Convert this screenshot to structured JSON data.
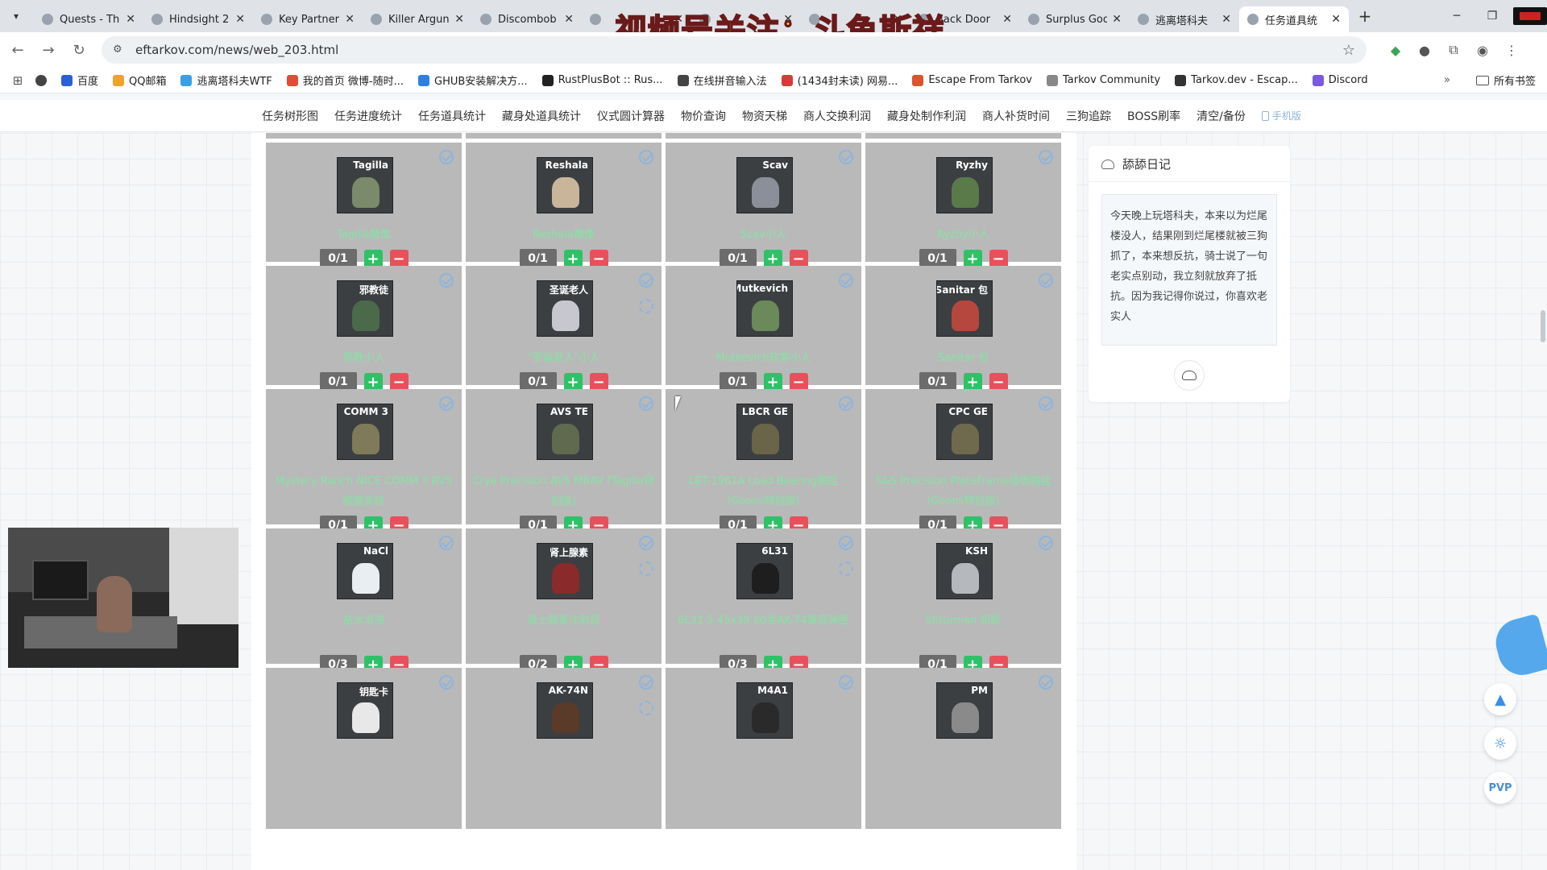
{
  "browser": {
    "tabs": [
      {
        "title": "Quests - Th",
        "active": false
      },
      {
        "title": "Hindsight 2",
        "active": false
      },
      {
        "title": "Key Partner",
        "active": false
      },
      {
        "title": "Killer Argun",
        "active": false
      },
      {
        "title": "Discombob",
        "active": false
      },
      {
        "title": "",
        "active": false
      },
      {
        "title": "",
        "active": false
      },
      {
        "title": "",
        "active": false
      },
      {
        "title": "Back Door",
        "active": false
      },
      {
        "title": "Surplus Goo",
        "active": false
      },
      {
        "title": "逃离塔科夫",
        "active": false
      },
      {
        "title": "任务道具统",
        "active": true
      }
    ],
    "url": "eftarkov.com/news/web_203.html",
    "bookmarks": [
      {
        "label": "百度",
        "color": "#2b5fd6"
      },
      {
        "label": "QQ邮箱",
        "color": "#f0a22a"
      },
      {
        "label": "逃离塔科夫WTF",
        "color": "#3aa0e6"
      },
      {
        "label": "我的首页 微博-随时...",
        "color": "#e24b3a"
      },
      {
        "label": "GHUB安装解决方...",
        "color": "#2f7fe0"
      },
      {
        "label": "RustPlusBot :: Rus...",
        "color": "#222222"
      },
      {
        "label": "在线拼音输入法",
        "color": "#444444"
      },
      {
        "label": "(1434封未读) 网易...",
        "color": "#d83a3a"
      },
      {
        "label": "Escape From Tarkov",
        "color": "#d9552b"
      },
      {
        "label": "Tarkov Community",
        "color": "#888888"
      },
      {
        "label": "Tarkov.dev - Escap...",
        "color": "#333333"
      },
      {
        "label": "Discord",
        "color": "#7a5ae0"
      }
    ],
    "all_bookmarks": "所有书签",
    "more": "»"
  },
  "watermark": "视频号关注：斗鱼斯祥、",
  "sitenav": {
    "items": [
      "任务树形图",
      "任务进度统计",
      "任务道具统计",
      "藏身处道具统计",
      "仪式圆计算器",
      "物价查询",
      "物资天梯",
      "商人交换利润",
      "藏身处制作利润",
      "商人补货时间",
      "三狗追踪",
      "BOSS刷率",
      "清空/备份"
    ],
    "mobile": "手机版"
  },
  "cards": [
    {
      "tag": "Tagilla",
      "name": "Tagilla雕像",
      "count": "0/1",
      "fir": false,
      "color": "#7a8a6a"
    },
    {
      "tag": "Reshala",
      "name": "Reshala雕像",
      "count": "0/1",
      "fir": false,
      "color": "#c9b59a"
    },
    {
      "tag": "Scav",
      "name": "Scav小人",
      "count": "0/1",
      "fir": false,
      "color": "#8a8f99"
    },
    {
      "tag": "Ryzhy",
      "name": "Ryzhy小人",
      "count": "0/1",
      "fir": false,
      "color": "#5a7a4a"
    },
    {
      "tag": "邪教徒",
      "name": "邪教小人",
      "count": "0/1",
      "fir": false,
      "color": "#4a6a4a"
    },
    {
      "tag": "圣诞老人",
      "name": "\"圣诞老人\"小人",
      "count": "0/1",
      "fir": true,
      "color": "#c7c7cf"
    },
    {
      "tag": "Mutkevich",
      "name": "Mutkevich玫客小人",
      "count": "0/1",
      "fir": false,
      "color": "#6a8a5a"
    },
    {
      "tag": "Sanitar 包",
      "name": "Sanitar 包",
      "count": "0/1",
      "fir": false,
      "color": "#b5473e"
    },
    {
      "tag": "COMM 3",
      "name": "Mystery Ranch NICE COMM 3 BVS框圈系统",
      "count": "0/1",
      "fir": false,
      "color": "#7f7a5a"
    },
    {
      "tag": "AVS TE",
      "name": "Crye Precision AVS MBAV (Tagilla特别版)",
      "count": "0/1",
      "fir": false,
      "color": "#5f6a4f"
    },
    {
      "tag": "LBCR GE",
      "name": "LBT-1961A Load Bearing胸挂 (Goons特别版)",
      "count": "0/1",
      "fir": false,
      "color": "#6a6448"
    },
    {
      "tag": "CPC GE",
      "name": "S&S Precision PlateFrame插板胸挂 (Goons特别版)",
      "count": "0/1",
      "fir": false,
      "color": "#6f6a4e"
    },
    {
      "tag": "NaCl",
      "name": "盐水溶液",
      "count": "0/3",
      "fir": false,
      "color": "#e8eef2"
    },
    {
      "tag": "肾上腺素",
      "name": "肾上腺素注射器",
      "count": "0/2",
      "fir": true,
      "color": "#8a2a2a"
    },
    {
      "tag": "6L31",
      "name": "6L31 5.45x39 60发AK-74兼容弹匣",
      "count": "0/3",
      "fir": true,
      "color": "#1e1e1e"
    },
    {
      "tag": "KSH",
      "name": "Shturman 钥匙",
      "count": "0/1",
      "fir": false,
      "color": "#b5b9be"
    },
    {
      "tag": "钥匙卡",
      "name": "",
      "count": "",
      "fir": false,
      "color": "#e8e8e8"
    },
    {
      "tag": "AK-74N",
      "name": "",
      "count": "",
      "fir": true,
      "color": "#5a3a28"
    },
    {
      "tag": "M4A1",
      "name": "",
      "count": "",
      "fir": false,
      "color": "#2a2a2a"
    },
    {
      "tag": "PM",
      "name": "",
      "count": "",
      "fir": false,
      "color": "#8a8a8a"
    }
  ],
  "diary": {
    "title": "舔舔日记",
    "text": "今天晚上玩塔科夫，本来以为烂尾楼没人，结果刚到烂尾楼就被三狗抓了，本来想反抗，骑士说了一句老实点别动，我立刻就放弃了抵抗。因为我记得你说过，你喜欢老实人"
  },
  "fabs": {
    "top": "rocket-icon",
    "theme": "sun-icon",
    "pvp": "PVP"
  }
}
